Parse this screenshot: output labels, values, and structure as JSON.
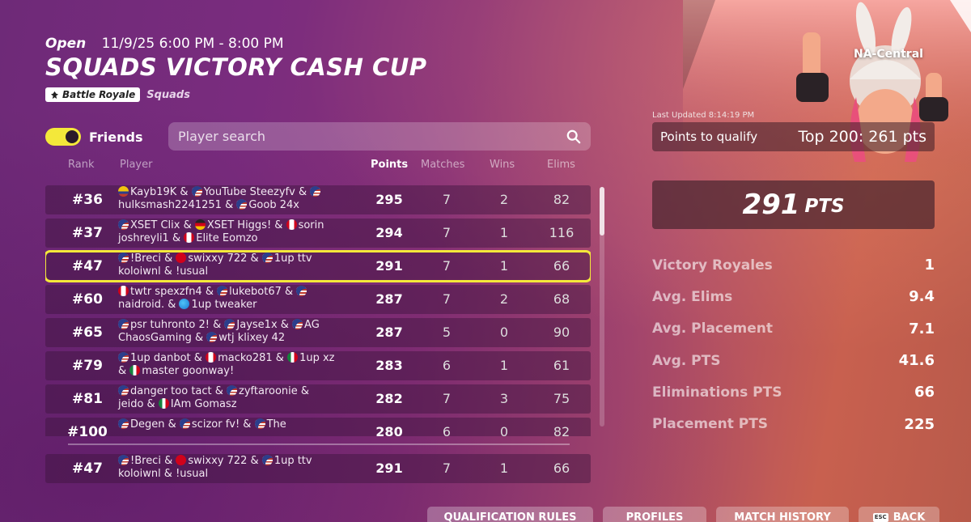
{
  "header": {
    "status": "Open",
    "time": "11/9/25 6:00 PM - 8:00 PM",
    "title": "SQUADS VICTORY CASH CUP",
    "mode_tag": "Battle Royale",
    "squad_tag": "Squads"
  },
  "toolbar": {
    "friends_label": "Friends",
    "friends_on": true,
    "search_placeholder": "Player search"
  },
  "columns": {
    "rank": "Rank",
    "player": "Player",
    "points": "Points",
    "matches": "Matches",
    "wins": "Wins",
    "elims": "Elims"
  },
  "rows": [
    {
      "rank": "#36",
      "p1": [
        [
          "co",
          "Kayb19K &"
        ],
        [
          "us",
          "YouTube Steezyfv &"
        ],
        [
          "us",
          ""
        ]
      ],
      "p2": [
        [
          "",
          "hulksmash2241251 &"
        ],
        [
          "us",
          "Goob 24x"
        ]
      ],
      "points": "295",
      "matches": "7",
      "wins": "2",
      "elims": "82"
    },
    {
      "rank": "#37",
      "p1": [
        [
          "us",
          "XSET Clix &"
        ],
        [
          "de",
          "XSET Higgs! &"
        ],
        [
          "ca",
          "sorin"
        ]
      ],
      "p2": [
        [
          "",
          "joshreyli1 &"
        ],
        [
          "ca",
          "Elite Eomzo"
        ]
      ],
      "points": "294",
      "matches": "7",
      "wins": "1",
      "elims": "116"
    },
    {
      "rank": "#47",
      "p1": [
        [
          "us",
          "!Breci &"
        ],
        [
          "ch",
          "swixxy 722 &"
        ],
        [
          "us",
          "1up ttv"
        ]
      ],
      "p2": [
        [
          "",
          "koloiwnl & !usual"
        ]
      ],
      "points": "291",
      "matches": "7",
      "wins": "1",
      "elims": "66",
      "highlight": true
    },
    {
      "rank": "#60",
      "p1": [
        [
          "ca",
          "twtr spexzfn4 &"
        ],
        [
          "us",
          "lukebot67 &"
        ],
        [
          "us",
          ""
        ]
      ],
      "p2": [
        [
          "",
          "naidroid. &"
        ],
        [
          "gl",
          "1up tweaker"
        ]
      ],
      "points": "287",
      "matches": "7",
      "wins": "2",
      "elims": "68"
    },
    {
      "rank": "#65",
      "p1": [
        [
          "us",
          "psr tuhronto 2! &"
        ],
        [
          "us",
          "Jayse1x &"
        ],
        [
          "us",
          "AG"
        ]
      ],
      "p2": [
        [
          "",
          "ChaosGaming &"
        ],
        [
          "us",
          "wtj klixey 42"
        ]
      ],
      "points": "287",
      "matches": "5",
      "wins": "0",
      "elims": "90"
    },
    {
      "rank": "#79",
      "p1": [
        [
          "us",
          "1up danbot &"
        ],
        [
          "ca",
          "macko281 &"
        ],
        [
          "mx",
          "1up xz"
        ]
      ],
      "p2": [
        [
          "",
          "&"
        ],
        [
          "mx",
          "master goonway!"
        ]
      ],
      "points": "283",
      "matches": "6",
      "wins": "1",
      "elims": "61"
    },
    {
      "rank": "#81",
      "p1": [
        [
          "us",
          "danger too tact &"
        ],
        [
          "us",
          "zyftaroonie &"
        ]
      ],
      "p2": [
        [
          "",
          "jeido &"
        ],
        [
          "mx",
          "IAm Gomasz"
        ]
      ],
      "points": "282",
      "matches": "7",
      "wins": "3",
      "elims": "75"
    },
    {
      "rank": "#100",
      "p1": [
        [
          "us",
          "Degen &"
        ],
        [
          "us",
          "scizor fv! &"
        ],
        [
          "us",
          "The"
        ]
      ],
      "p2": [
        [
          "",
          ""
        ]
      ],
      "points": "280",
      "matches": "6",
      "wins": "0",
      "elims": "82"
    }
  ],
  "me_row": {
    "rank": "#47",
    "p1": [
      [
        "us",
        "!Breci &"
      ],
      [
        "ch",
        "swixxy 722 &"
      ],
      [
        "us",
        "1up ttv"
      ]
    ],
    "p2": [
      [
        "",
        "koloiwnl & !usual"
      ]
    ],
    "points": "291",
    "matches": "7",
    "wins": "1",
    "elims": "66"
  },
  "panel": {
    "region": "NA-Central",
    "last_updated": "Last Updated 8:14:19 PM",
    "qualify_label": "Points to qualify",
    "qualify_value": "Top 200: 261 pts",
    "total_points": "291",
    "total_unit": "PTS",
    "stats": [
      {
        "label": "Victory Royales",
        "value": "1"
      },
      {
        "label": "Avg. Elims",
        "value": "9.4"
      },
      {
        "label": "Avg. Placement",
        "value": "7.1"
      },
      {
        "label": "Avg. PTS",
        "value": "41.6"
      },
      {
        "label": "Eliminations PTS",
        "value": "66"
      },
      {
        "label": "Placement PTS",
        "value": "225"
      }
    ]
  },
  "buttons": {
    "qualification_rules": "QUALIFICATION RULES",
    "profiles": "PROFILES",
    "match_history": "MATCH HISTORY",
    "esc_key": "ESC",
    "back": "BACK"
  },
  "colors": {
    "accent_yellow": "#f4e83a",
    "row_bg": "#3c143c"
  }
}
